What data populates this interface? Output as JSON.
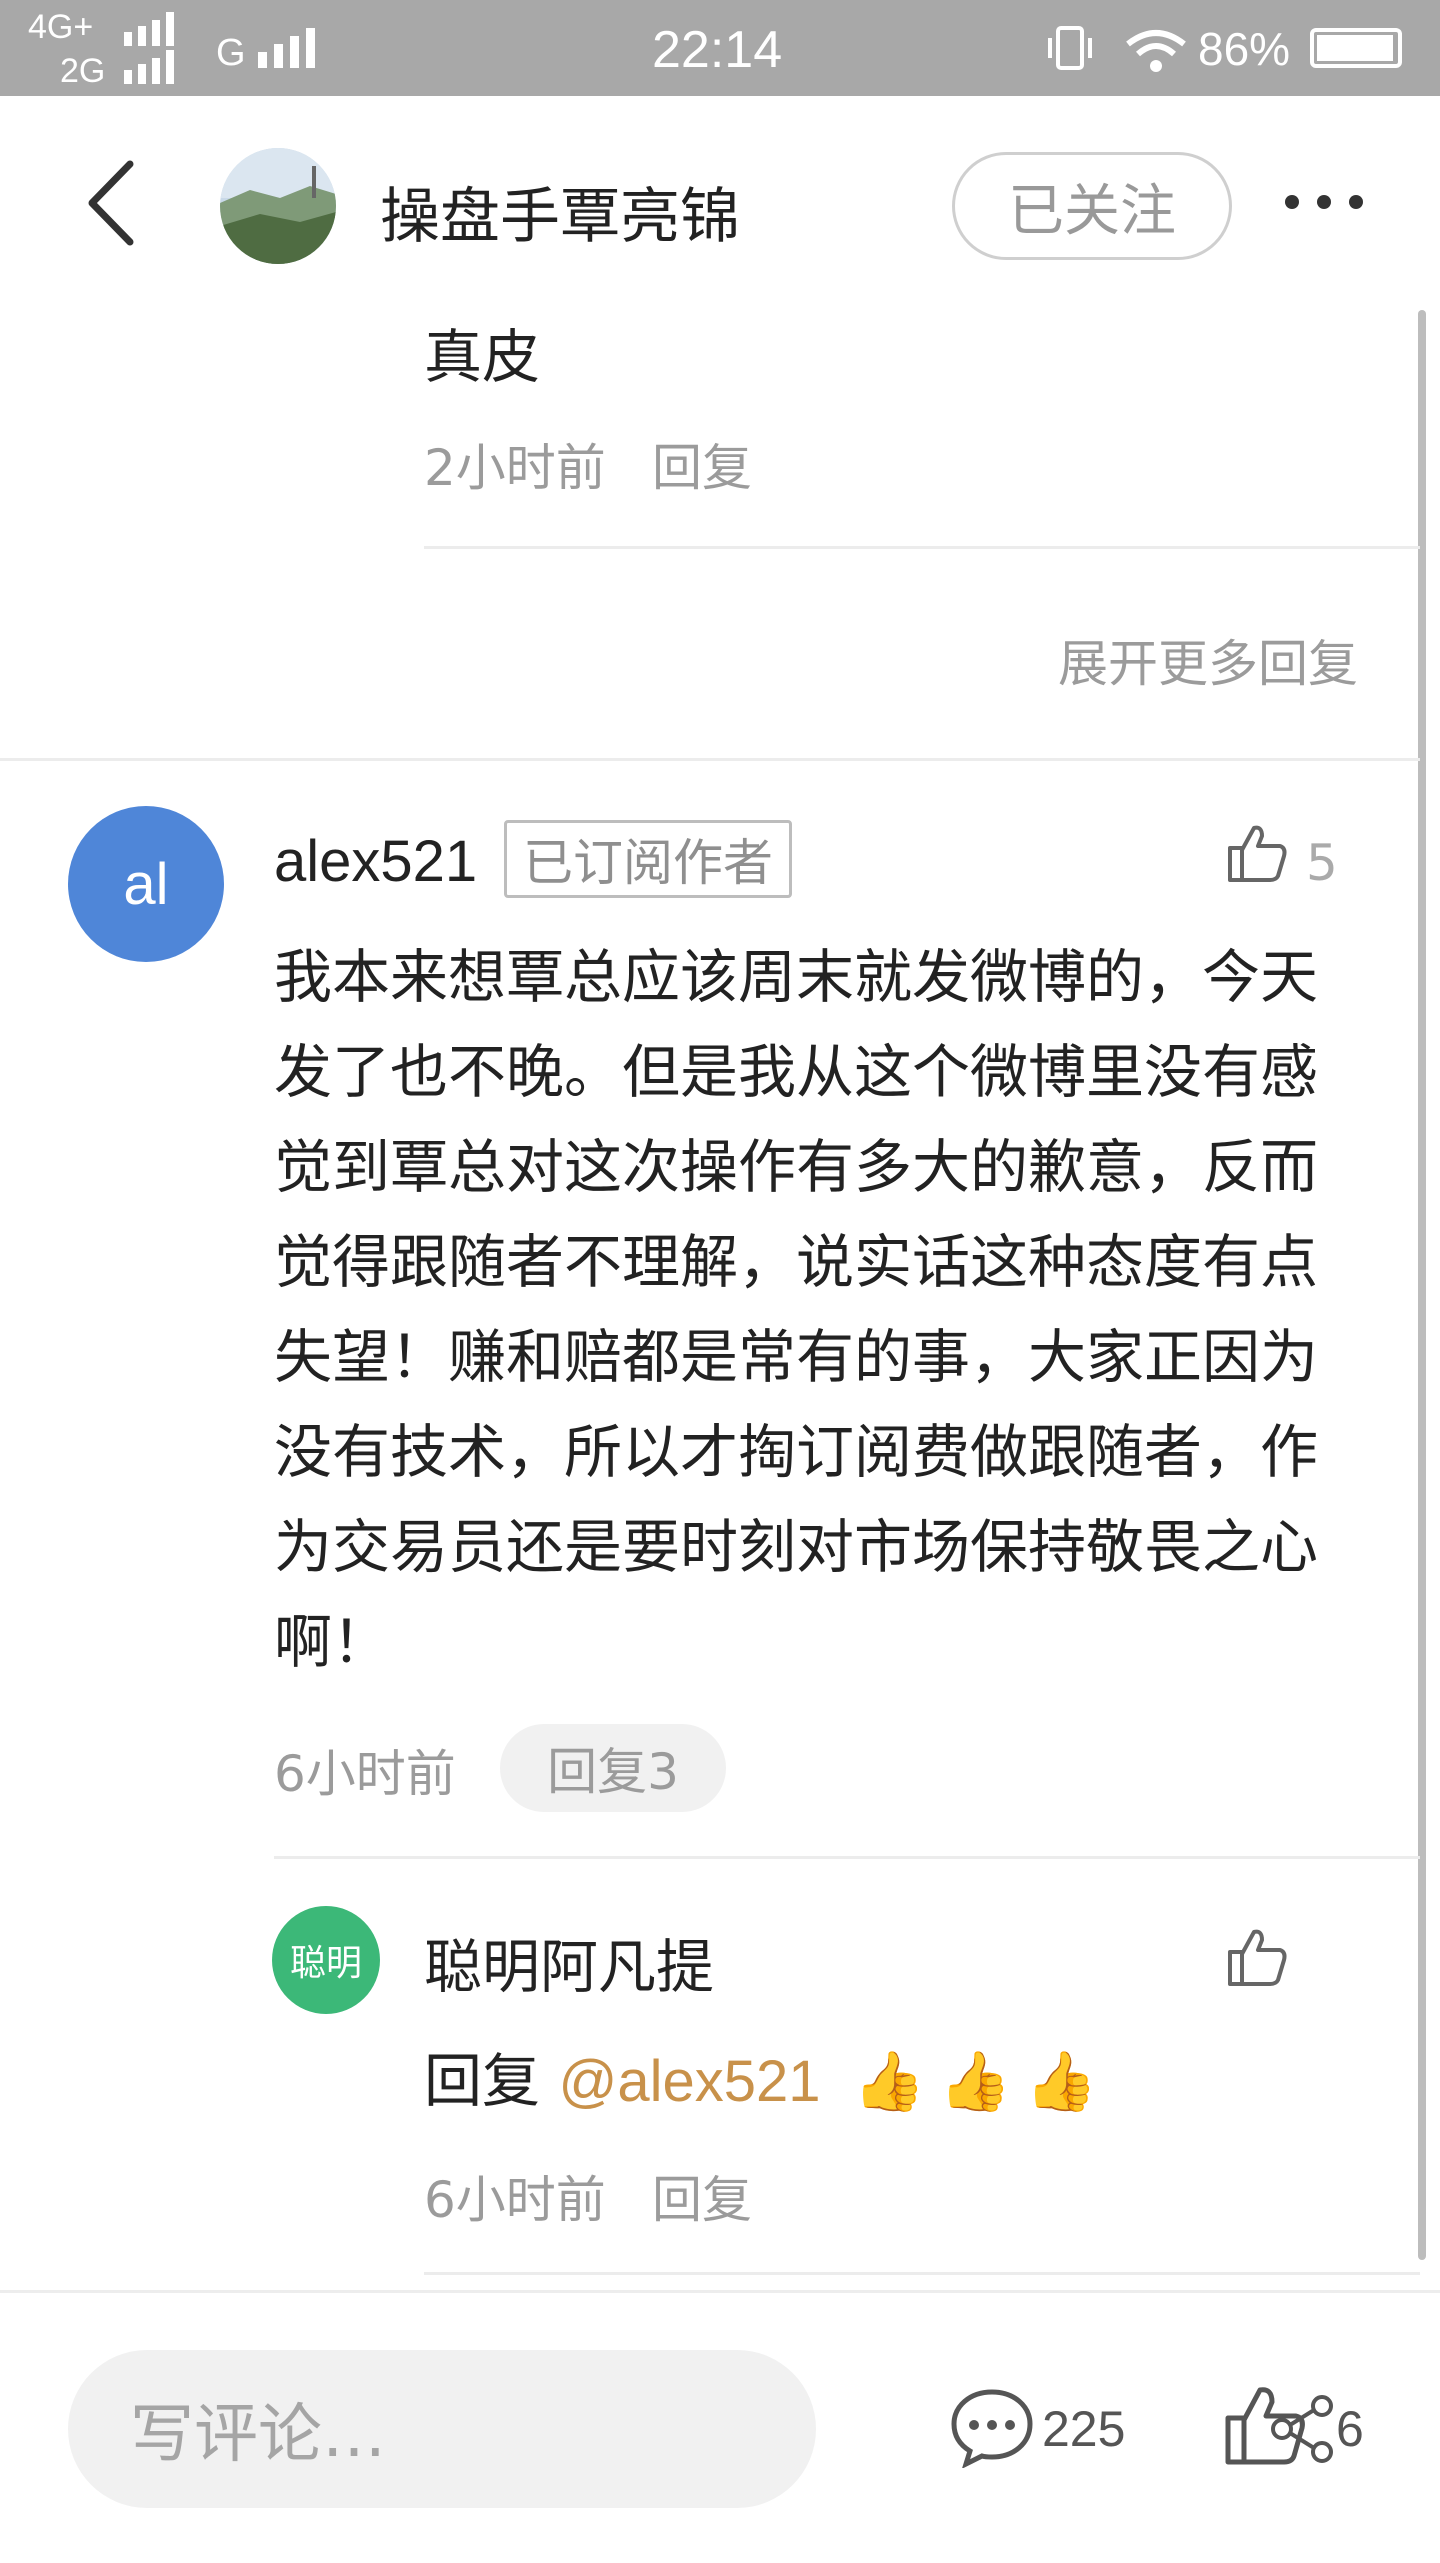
{
  "status_bar": {
    "net1": "4G+",
    "net2": "2G",
    "net3": "G",
    "time": "22:14",
    "battery": "86%"
  },
  "header": {
    "author_name": "操盘手覃亮锦",
    "follow_label": "已关注"
  },
  "reply_top": {
    "text": "真皮",
    "time": "2小时前",
    "reply_label": "回复"
  },
  "expand_more": "展开更多回复",
  "comment": {
    "avatar_text": "al",
    "username": "alex521",
    "badge": "已订阅作者",
    "like_count": "5",
    "body": "我本来想覃总应该周末就发微博的，今天发了也不晚。但是我从这个微博里没有感觉到覃总对这次操作有多大的歉意，反而觉得跟随者不理解，说实话这种态度有点失望！赚和赔都是常有的事，大家正因为没有技术，所以才掏订阅费做跟随者，作为交易员还是要时刻对市场保持敬畏之心啊！",
    "time": "6小时前",
    "reply_count_label": "回复3"
  },
  "sub_reply": {
    "avatar_text": "聪明",
    "username": "聪明阿凡提",
    "prefix": "回复 ",
    "mention": "@alex521",
    "emojis": "👍👍👍",
    "time": "6小时前",
    "reply_label": "回复"
  },
  "bottom_bar": {
    "input_placeholder": "写评论…",
    "comment_count": "225",
    "like_count": "6"
  },
  "colors": {
    "mention": "#c8914a",
    "avatar_blue": "#4f86d8",
    "avatar_green": "#3cb878",
    "status_bar": "#a8a8a8"
  }
}
